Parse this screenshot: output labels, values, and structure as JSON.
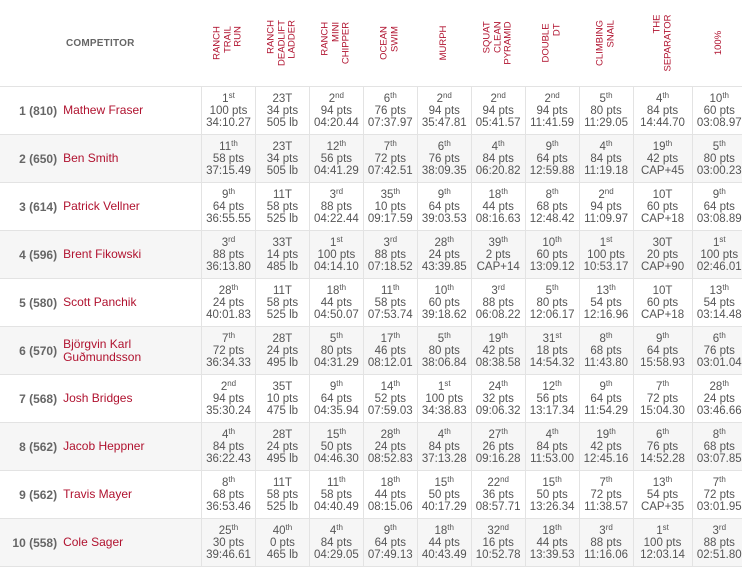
{
  "header": {
    "competitor_label": "COMPETITOR",
    "events": [
      {
        "label": "RANCH\nTRAIL\nRUN"
      },
      {
        "label": "RANCH\nDEADLIFT\nLADDER"
      },
      {
        "label": "RANCH\nMINI\nCHIPPER"
      },
      {
        "label": "OCEAN\nSWIM"
      },
      {
        "label": "MURPH"
      },
      {
        "label": "SQUAT\nCLEAN\nPYRAMID"
      },
      {
        "label": "DOUBLE\nDT"
      },
      {
        "label": "CLIMBING\nSNAIL"
      },
      {
        "label": "THE\nSEPARATOR"
      },
      {
        "label": "100%"
      }
    ]
  },
  "colors": {
    "accent": "#b0122f",
    "row_alt": "#f6f6f6",
    "border": "#e3e3e3"
  },
  "rows": [
    {
      "rank": "1 (810)",
      "name": "Mathew Fraser",
      "results": [
        {
          "place": "1",
          "suffix": "st",
          "pts": "100 pts",
          "score": "34:10.27"
        },
        {
          "place": "23T",
          "suffix": "",
          "pts": "34 pts",
          "score": "505 lb"
        },
        {
          "place": "2",
          "suffix": "nd",
          "pts": "94 pts",
          "score": "04:20.44"
        },
        {
          "place": "6",
          "suffix": "th",
          "pts": "76 pts",
          "score": "07:37.97"
        },
        {
          "place": "2",
          "suffix": "nd",
          "pts": "94 pts",
          "score": "35:47.81"
        },
        {
          "place": "2",
          "suffix": "nd",
          "pts": "94 pts",
          "score": "05:41.57"
        },
        {
          "place": "2",
          "suffix": "nd",
          "pts": "94 pts",
          "score": "11:41.59"
        },
        {
          "place": "5",
          "suffix": "th",
          "pts": "80 pts",
          "score": "11:29.05"
        },
        {
          "place": "4",
          "suffix": "th",
          "pts": "84 pts",
          "score": "14:44.70"
        },
        {
          "place": "10",
          "suffix": "th",
          "pts": "60 pts",
          "score": "03:08.97"
        }
      ]
    },
    {
      "rank": "2 (650)",
      "name": "Ben Smith",
      "results": [
        {
          "place": "11",
          "suffix": "th",
          "pts": "58 pts",
          "score": "37:15.49"
        },
        {
          "place": "23T",
          "suffix": "",
          "pts": "34 pts",
          "score": "505 lb"
        },
        {
          "place": "12",
          "suffix": "th",
          "pts": "56 pts",
          "score": "04:41.29"
        },
        {
          "place": "7",
          "suffix": "th",
          "pts": "72 pts",
          "score": "07:42.51"
        },
        {
          "place": "6",
          "suffix": "th",
          "pts": "76 pts",
          "score": "38:09.35"
        },
        {
          "place": "4",
          "suffix": "th",
          "pts": "84 pts",
          "score": "06:20.82"
        },
        {
          "place": "9",
          "suffix": "th",
          "pts": "64 pts",
          "score": "12:59.88"
        },
        {
          "place": "4",
          "suffix": "th",
          "pts": "84 pts",
          "score": "11:19.18"
        },
        {
          "place": "19",
          "suffix": "th",
          "pts": "42 pts",
          "score": "CAP+45"
        },
        {
          "place": "5",
          "suffix": "th",
          "pts": "80 pts",
          "score": "03:00.23"
        }
      ]
    },
    {
      "rank": "3 (614)",
      "name": "Patrick Vellner",
      "results": [
        {
          "place": "9",
          "suffix": "th",
          "pts": "64 pts",
          "score": "36:55.55"
        },
        {
          "place": "11T",
          "suffix": "",
          "pts": "58 pts",
          "score": "525 lb"
        },
        {
          "place": "3",
          "suffix": "rd",
          "pts": "88 pts",
          "score": "04:22.44"
        },
        {
          "place": "35",
          "suffix": "th",
          "pts": "10 pts",
          "score": "09:17.59"
        },
        {
          "place": "9",
          "suffix": "th",
          "pts": "64 pts",
          "score": "39:03.53"
        },
        {
          "place": "18",
          "suffix": "th",
          "pts": "44 pts",
          "score": "08:16.63"
        },
        {
          "place": "8",
          "suffix": "th",
          "pts": "68 pts",
          "score": "12:48.42"
        },
        {
          "place": "2",
          "suffix": "nd",
          "pts": "94 pts",
          "score": "11:09.97"
        },
        {
          "place": "10T",
          "suffix": "",
          "pts": "60 pts",
          "score": "CAP+18"
        },
        {
          "place": "9",
          "suffix": "th",
          "pts": "64 pts",
          "score": "03:08.89"
        }
      ]
    },
    {
      "rank": "4 (596)",
      "name": "Brent Fikowski",
      "results": [
        {
          "place": "3",
          "suffix": "rd",
          "pts": "88 pts",
          "score": "36:13.80"
        },
        {
          "place": "33T",
          "suffix": "",
          "pts": "14 pts",
          "score": "485 lb"
        },
        {
          "place": "1",
          "suffix": "st",
          "pts": "100 pts",
          "score": "04:14.10"
        },
        {
          "place": "3",
          "suffix": "rd",
          "pts": "88 pts",
          "score": "07:18.52"
        },
        {
          "place": "28",
          "suffix": "th",
          "pts": "24 pts",
          "score": "43:39.85"
        },
        {
          "place": "39",
          "suffix": "th",
          "pts": "2 pts",
          "score": "CAP+14"
        },
        {
          "place": "10",
          "suffix": "th",
          "pts": "60 pts",
          "score": "13:09.12"
        },
        {
          "place": "1",
          "suffix": "st",
          "pts": "100 pts",
          "score": "10:53.17"
        },
        {
          "place": "30T",
          "suffix": "",
          "pts": "20 pts",
          "score": "CAP+90"
        },
        {
          "place": "1",
          "suffix": "st",
          "pts": "100 pts",
          "score": "02:46.01"
        }
      ]
    },
    {
      "rank": "5 (580)",
      "name": "Scott Panchik",
      "results": [
        {
          "place": "28",
          "suffix": "th",
          "pts": "24 pts",
          "score": "40:01.83"
        },
        {
          "place": "11T",
          "suffix": "",
          "pts": "58 pts",
          "score": "525 lb"
        },
        {
          "place": "18",
          "suffix": "th",
          "pts": "44 pts",
          "score": "04:50.07"
        },
        {
          "place": "11",
          "suffix": "th",
          "pts": "58 pts",
          "score": "07:53.74"
        },
        {
          "place": "10",
          "suffix": "th",
          "pts": "60 pts",
          "score": "39:18.62"
        },
        {
          "place": "3",
          "suffix": "rd",
          "pts": "88 pts",
          "score": "06:08.22"
        },
        {
          "place": "5",
          "suffix": "th",
          "pts": "80 pts",
          "score": "12:06.17"
        },
        {
          "place": "13",
          "suffix": "th",
          "pts": "54 pts",
          "score": "12:16.96"
        },
        {
          "place": "10T",
          "suffix": "",
          "pts": "60 pts",
          "score": "CAP+18"
        },
        {
          "place": "13",
          "suffix": "th",
          "pts": "54 pts",
          "score": "03:14.48"
        }
      ]
    },
    {
      "rank": "6 (570)",
      "name": "Björgvin Karl Guðmundsson",
      "results": [
        {
          "place": "7",
          "suffix": "th",
          "pts": "72 pts",
          "score": "36:34.33"
        },
        {
          "place": "28T",
          "suffix": "",
          "pts": "24 pts",
          "score": "495 lb"
        },
        {
          "place": "5",
          "suffix": "th",
          "pts": "80 pts",
          "score": "04:31.29"
        },
        {
          "place": "17",
          "suffix": "th",
          "pts": "46 pts",
          "score": "08:12.01"
        },
        {
          "place": "5",
          "suffix": "th",
          "pts": "80 pts",
          "score": "38:06.84"
        },
        {
          "place": "19",
          "suffix": "th",
          "pts": "42 pts",
          "score": "08:38.58"
        },
        {
          "place": "31",
          "suffix": "st",
          "pts": "18 pts",
          "score": "14:54.32"
        },
        {
          "place": "8",
          "suffix": "th",
          "pts": "68 pts",
          "score": "11:43.80"
        },
        {
          "place": "9",
          "suffix": "th",
          "pts": "64 pts",
          "score": "15:58.93"
        },
        {
          "place": "6",
          "suffix": "th",
          "pts": "76 pts",
          "score": "03:01.04"
        }
      ]
    },
    {
      "rank": "7 (568)",
      "name": "Josh Bridges",
      "results": [
        {
          "place": "2",
          "suffix": "nd",
          "pts": "94 pts",
          "score": "35:30.24"
        },
        {
          "place": "35T",
          "suffix": "",
          "pts": "10 pts",
          "score": "475 lb"
        },
        {
          "place": "9",
          "suffix": "th",
          "pts": "64 pts",
          "score": "04:35.94"
        },
        {
          "place": "14",
          "suffix": "th",
          "pts": "52 pts",
          "score": "07:59.03"
        },
        {
          "place": "1",
          "suffix": "st",
          "pts": "100 pts",
          "score": "34:38.83"
        },
        {
          "place": "24",
          "suffix": "th",
          "pts": "32 pts",
          "score": "09:06.32"
        },
        {
          "place": "12",
          "suffix": "th",
          "pts": "56 pts",
          "score": "13:17.34"
        },
        {
          "place": "9",
          "suffix": "th",
          "pts": "64 pts",
          "score": "11:54.29"
        },
        {
          "place": "7",
          "suffix": "th",
          "pts": "72 pts",
          "score": "15:04.30"
        },
        {
          "place": "28",
          "suffix": "th",
          "pts": "24 pts",
          "score": "03:46.66"
        }
      ]
    },
    {
      "rank": "8 (562)",
      "name": "Jacob Heppner",
      "results": [
        {
          "place": "4",
          "suffix": "th",
          "pts": "84 pts",
          "score": "36:22.43"
        },
        {
          "place": "28T",
          "suffix": "",
          "pts": "24 pts",
          "score": "495 lb"
        },
        {
          "place": "15",
          "suffix": "th",
          "pts": "50 pts",
          "score": "04:46.30"
        },
        {
          "place": "28",
          "suffix": "th",
          "pts": "24 pts",
          "score": "08:52.83"
        },
        {
          "place": "4",
          "suffix": "th",
          "pts": "84 pts",
          "score": "37:13.28"
        },
        {
          "place": "27",
          "suffix": "th",
          "pts": "26 pts",
          "score": "09:16.28"
        },
        {
          "place": "4",
          "suffix": "th",
          "pts": "84 pts",
          "score": "11:53.00"
        },
        {
          "place": "19",
          "suffix": "th",
          "pts": "42 pts",
          "score": "12:45.16"
        },
        {
          "place": "6",
          "suffix": "th",
          "pts": "76 pts",
          "score": "14:52.28"
        },
        {
          "place": "8",
          "suffix": "th",
          "pts": "68 pts",
          "score": "03:07.85"
        }
      ]
    },
    {
      "rank": "9 (562)",
      "name": "Travis Mayer",
      "results": [
        {
          "place": "8",
          "suffix": "th",
          "pts": "68 pts",
          "score": "36:53.46"
        },
        {
          "place": "11T",
          "suffix": "",
          "pts": "58 pts",
          "score": "525 lb"
        },
        {
          "place": "11",
          "suffix": "th",
          "pts": "58 pts",
          "score": "04:40.49"
        },
        {
          "place": "18",
          "suffix": "th",
          "pts": "44 pts",
          "score": "08:15.06"
        },
        {
          "place": "15",
          "suffix": "th",
          "pts": "50 pts",
          "score": "40:17.29"
        },
        {
          "place": "22",
          "suffix": "nd",
          "pts": "36 pts",
          "score": "08:57.71"
        },
        {
          "place": "15",
          "suffix": "th",
          "pts": "50 pts",
          "score": "13:26.34"
        },
        {
          "place": "7",
          "suffix": "th",
          "pts": "72 pts",
          "score": "11:38.57"
        },
        {
          "place": "13",
          "suffix": "th",
          "pts": "54 pts",
          "score": "CAP+35"
        },
        {
          "place": "7",
          "suffix": "th",
          "pts": "72 pts",
          "score": "03:01.95"
        }
      ]
    },
    {
      "rank": "10 (558)",
      "name": "Cole Sager",
      "results": [
        {
          "place": "25",
          "suffix": "th",
          "pts": "30 pts",
          "score": "39:46.61"
        },
        {
          "place": "40",
          "suffix": "th",
          "pts": "0 pts",
          "score": "465 lb"
        },
        {
          "place": "4",
          "suffix": "th",
          "pts": "84 pts",
          "score": "04:29.05"
        },
        {
          "place": "9",
          "suffix": "th",
          "pts": "64 pts",
          "score": "07:49.13"
        },
        {
          "place": "18",
          "suffix": "th",
          "pts": "44 pts",
          "score": "40:43.49"
        },
        {
          "place": "32",
          "suffix": "nd",
          "pts": "16 pts",
          "score": "10:52.78"
        },
        {
          "place": "18",
          "suffix": "th",
          "pts": "44 pts",
          "score": "13:39.53"
        },
        {
          "place": "3",
          "suffix": "rd",
          "pts": "88 pts",
          "score": "11:16.06"
        },
        {
          "place": "1",
          "suffix": "st",
          "pts": "100 pts",
          "score": "12:03.14"
        },
        {
          "place": "3",
          "suffix": "rd",
          "pts": "88 pts",
          "score": "02:51.80"
        }
      ]
    }
  ]
}
